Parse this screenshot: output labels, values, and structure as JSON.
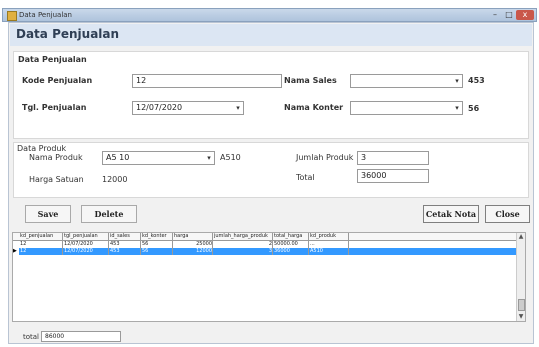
{
  "window": {
    "title": "Data Penjualan",
    "minimize": "–",
    "maximize": "□",
    "close": "x"
  },
  "header": {
    "title": "Data Penjualan"
  },
  "penjualan": {
    "section_label": "Data Penjualan",
    "kode_label": "Kode Penjualan",
    "kode_value": "12",
    "tgl_label": "Tgl. Penjualan",
    "tgl_value": "12/07/2020",
    "sales_label": "Nama Sales",
    "sales_value": "",
    "sales_id": "453",
    "konter_label": "Nama Konter",
    "konter_value": "",
    "konter_id": "56",
    "dropdown_arrow": "▾"
  },
  "produk": {
    "section_label": "Data Produk",
    "nama_label": "Nama Produk",
    "nama_value": "A5 10",
    "nama_id": "A510",
    "harga_label": "Harga Satuan",
    "harga_value": "12000",
    "jumlah_label": "Jumlah Produk",
    "jumlah_value": "3",
    "total_label": "Total",
    "total_value": "36000"
  },
  "buttons": {
    "save": "Save",
    "delete": "Delete",
    "cetak": "Cetak Nota",
    "close": "Close"
  },
  "table": {
    "columns": [
      "kd_penjualan",
      "tgl_penjualan",
      "id_sales",
      "kd_konter",
      "harga",
      "jumlah_harga_produk",
      "total_harga",
      "kd_produk"
    ],
    "rows": [
      [
        "12",
        "12/07/2020",
        "453",
        "56",
        "25000",
        "2",
        "50000.00",
        "..."
      ],
      [
        "12",
        "12/07/2020",
        "453",
        "56",
        "12000",
        "3",
        "36000",
        "A510"
      ]
    ],
    "selected_row": 1,
    "row_indicator": "▶",
    "scroll_up": "▲",
    "scroll_down": "▼"
  },
  "footer": {
    "total_label": "total",
    "total_value": "86000"
  }
}
